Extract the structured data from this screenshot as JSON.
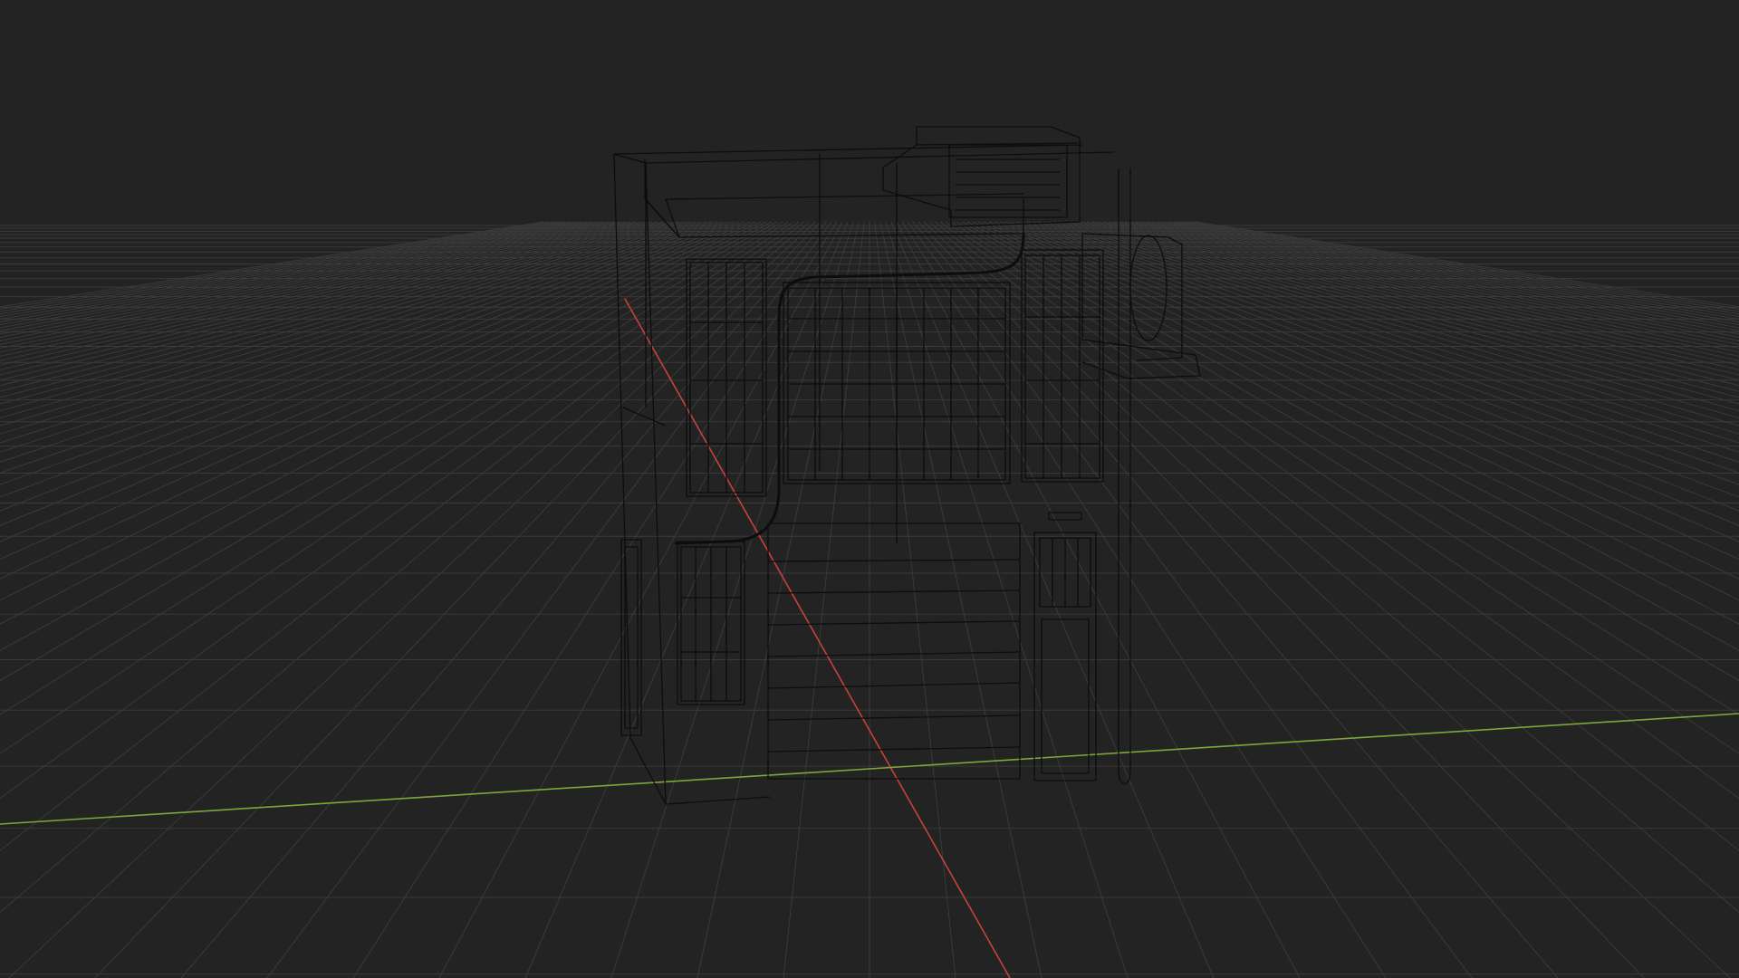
{
  "viewport": {
    "background": "#232323",
    "view_mode": "wireframe",
    "perspective": "3D perspective"
  },
  "grid": {
    "color": "#3a3a3a",
    "visible": true
  },
  "axes": {
    "x_axis_color": "#c8413b",
    "y_axis_color": "#7fa63a"
  },
  "model": {
    "wire_color": "#0d0d0d",
    "name": "building-wireframe"
  }
}
